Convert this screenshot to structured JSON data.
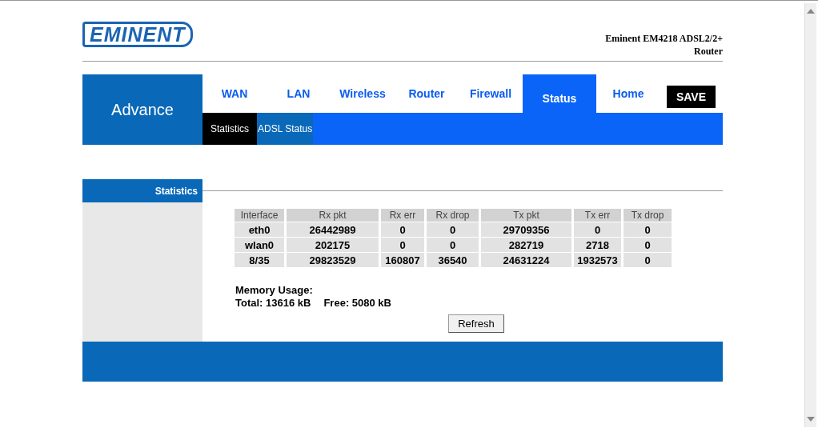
{
  "logo": "EMINENT",
  "product_title": "Eminent EM4218 ADSL2/2+ Router",
  "section_title": "Advance",
  "tabs": [
    {
      "label": "WAN",
      "selected": false
    },
    {
      "label": "LAN",
      "selected": false
    },
    {
      "label": "Wireless",
      "selected": false
    },
    {
      "label": "Router",
      "selected": false
    },
    {
      "label": "Firewall",
      "selected": false
    },
    {
      "label": "Status",
      "selected": true
    },
    {
      "label": "Home",
      "selected": false
    }
  ],
  "save_button": "SAVE",
  "subtabs": [
    {
      "label": "Statistics",
      "selected": true
    },
    {
      "label": "ADSL Status",
      "selected": false
    }
  ],
  "panel_title": "Statistics",
  "table": {
    "columns": [
      "Interface",
      "Rx pkt",
      "Rx err",
      "Rx drop",
      "Tx pkt",
      "Tx err",
      "Tx drop"
    ],
    "rows": [
      [
        "eth0",
        "26442989",
        "0",
        "0",
        "29709356",
        "0",
        "0"
      ],
      [
        "wlan0",
        "202175",
        "0",
        "0",
        "282719",
        "2718",
        "0"
      ],
      [
        "8/35",
        "29823529",
        "160807",
        "36540",
        "24631224",
        "1932573",
        "0"
      ]
    ]
  },
  "memory": {
    "heading": "Memory Usage:",
    "total": "Total: 13616 kB",
    "free": "Free: 5080 kB"
  },
  "refresh_button": "Refresh"
}
